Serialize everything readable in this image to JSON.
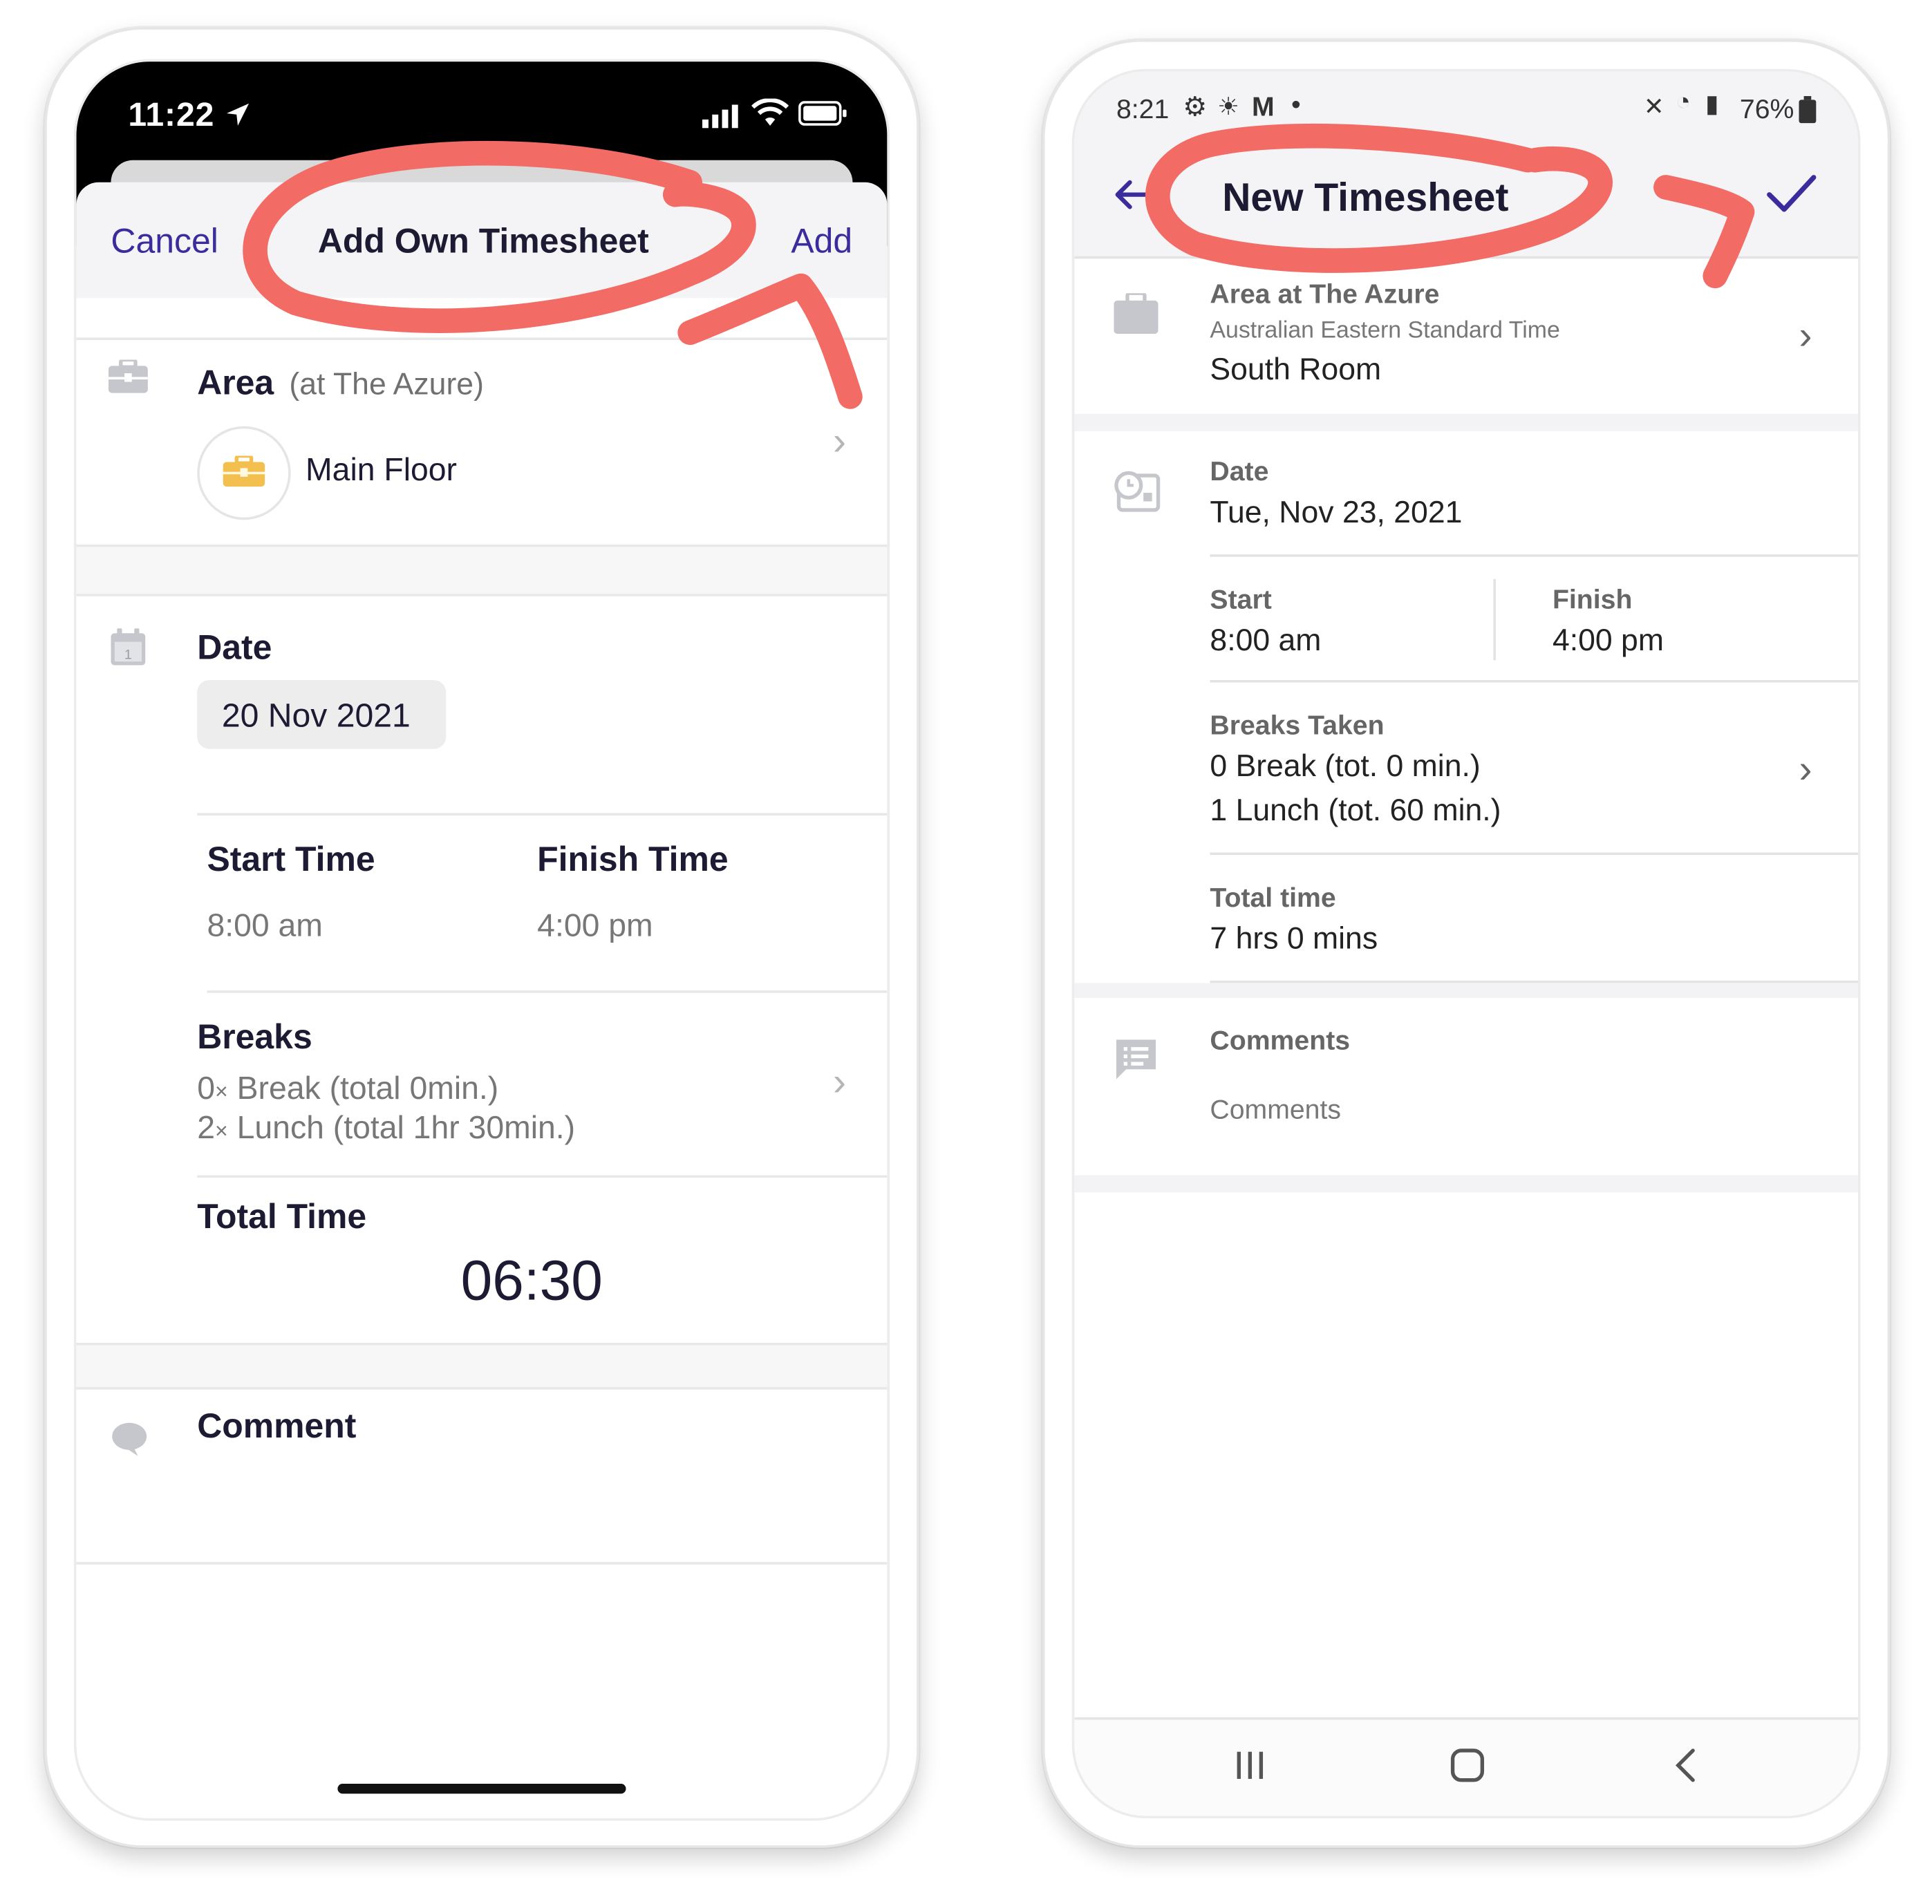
{
  "ios": {
    "status": {
      "time": "11:22"
    },
    "nav": {
      "cancel": "Cancel",
      "title": "Add Own Timesheet",
      "add": "Add"
    },
    "area": {
      "label": "Area",
      "location": "(at The Azure)",
      "value": "Main Floor"
    },
    "date": {
      "label": "Date",
      "value": "20 Nov 2021"
    },
    "times": {
      "start_label": "Start Time",
      "start_value": "8:00 am",
      "finish_label": "Finish Time",
      "finish_value": "4:00 pm"
    },
    "breaks": {
      "label": "Breaks",
      "items": [
        {
          "count": "0",
          "mult": "×",
          "text": "Break (total 0min.)"
        },
        {
          "count": "2",
          "mult": "×",
          "text": "Lunch (total 1hr 30min.)"
        }
      ]
    },
    "total": {
      "label": "Total Time",
      "value": "06:30"
    },
    "comment": {
      "label": "Comment"
    }
  },
  "android": {
    "status": {
      "time": "8:21",
      "battery": "76%"
    },
    "toolbar": {
      "title": "New Timesheet"
    },
    "area": {
      "title": "Area at The Azure",
      "timezone": "Australian Eastern Standard Time",
      "value": "South Room"
    },
    "date": {
      "label": "Date",
      "value": "Tue, Nov 23, 2021"
    },
    "times": {
      "start_label": "Start",
      "start_value": "8:00 am",
      "finish_label": "Finish",
      "finish_value": "4:00 pm"
    },
    "breaks": {
      "label": "Breaks Taken",
      "line1": "0 Break (tot. 0 min.)",
      "line2": "1 Lunch (tot. 60 min.)"
    },
    "total": {
      "label": "Total time",
      "value": "7 hrs 0 mins"
    },
    "comments": {
      "label": "Comments",
      "placeholder": "Comments"
    }
  },
  "colors": {
    "accent": "#3b2c9e",
    "annotation": "#f26b65",
    "text_dark": "#1c1b33",
    "area_icon": "#f3c04f"
  }
}
